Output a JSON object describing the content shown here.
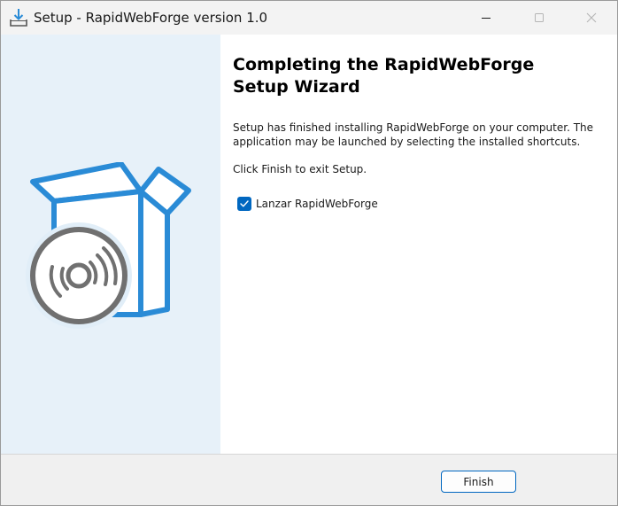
{
  "window": {
    "title": "Setup - RapidWebForge version 1.0",
    "controls": {
      "minimize": "minimize-icon",
      "maximize": "maximize-icon",
      "close": "close-icon"
    }
  },
  "sidebar": {
    "illustration": "software-box-with-disc"
  },
  "main": {
    "heading": "Completing the RapidWebForge\nSetup Wizard",
    "paragraph1": "Setup has finished installing RapidWebForge on your computer. The application may be launched by selecting the installed shortcuts.",
    "paragraph2": "Click Finish to exit Setup.",
    "launch_checkbox": {
      "label": "Lanzar RapidWebForge",
      "checked": true
    }
  },
  "footer": {
    "finish_label": "Finish"
  },
  "colors": {
    "accent": "#0067c0",
    "box_blue": "#2a8bd6",
    "disc_gray": "#707070",
    "sidebar_bg": "#e7f1f9"
  }
}
